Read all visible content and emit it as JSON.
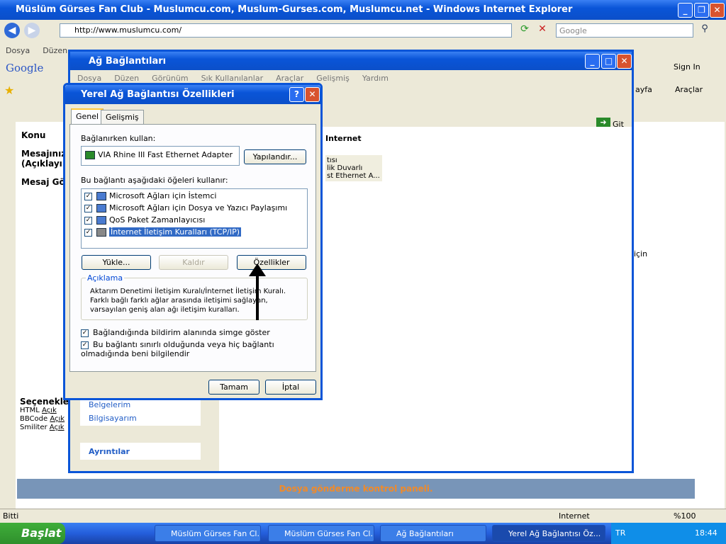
{
  "ie": {
    "title": "Müslüm Gürses Fan Club - Muslumcu.com, Muslum-Gurses.com, Muslumcu.net - Windows Internet Explorer",
    "address": "http://www.muslumcu.com/",
    "search_placeholder": "Google",
    "menu": [
      "Dosya",
      "Düzen"
    ],
    "google_label": "Google",
    "sign_in": "Sign In",
    "sayfa": "ayfa",
    "araclar": "Araçlar",
    "status": "Bitti",
    "zone": "Internet",
    "zoom": "%100"
  },
  "page": {
    "konu": "Konu",
    "mesajiniz": "Mesajınız (Açıklayı",
    "mesaj_go": "Mesaj Gö",
    "secenekler": "Seçenekle",
    "html": "HTML",
    "bbcode": "BBCode",
    "smiliter": "Smiliter",
    "acik": "Açık",
    "bottom_bar": "Dosya gönderme kontrol paneli.",
    "icin": "için"
  },
  "net": {
    "title": "Ağ Bağlantıları",
    "menu": [
      "Dosya",
      "Düzen",
      "Görünüm",
      "Sık Kullanılanlar",
      "Araçlar",
      "Gelişmiş",
      "Yardım"
    ],
    "go": "Git",
    "col_internet": "Internet",
    "rows": [
      "tısı",
      "lik Duvarlı",
      "st Ethernet A..."
    ],
    "side_links": [
      "Belgelerim",
      "Bilgisayarım"
    ],
    "ayrintilar": "Ayrıntılar"
  },
  "dlg": {
    "title": "Yerel Ağ Bağlantısı Özellikleri",
    "tabs": [
      "Genel",
      "Gelişmiş"
    ],
    "connect_using": "Bağlanırken kullan:",
    "adapter": "VIA Rhine III Fast Ethernet Adapter",
    "configure": "Yapılandır...",
    "items_label": "Bu bağlantı aşağıdaki öğeleri kullanır:",
    "items": [
      "Microsoft Ağları için İstemci",
      "Microsoft Ağları için Dosya ve Yazıcı Paylaşımı",
      "QoS Paket Zamanlayıcısı",
      "İnternet İletişim Kuralları (TCP/IP)"
    ],
    "install": "Yükle...",
    "uninstall": "Kaldır",
    "properties": "Özellikler",
    "desc_title": "Açıklama",
    "desc": "Aktarım Denetimi İletişim Kuralı/İnternet İletişim Kuralı. Farklı bağlı farklı ağlar arasında iletişimi sağlayan, varsayılan geniş alan ağı iletişim kuralları.",
    "show_icon": "Bağlandığında bildirim alanında simge göster",
    "notify": "Bu bağlantı sınırlı olduğunda veya hiç bağlantı olmadığında beni bilgilendir",
    "ok": "Tamam",
    "cancel": "İptal"
  },
  "taskbar": {
    "start": "Başlat",
    "tasks": [
      "Müslüm Gürses Fan Cl...",
      "Müslüm Gürses Fan Cl...",
      "Ağ Bağlantıları",
      "Yerel Ağ Bağlantısı Öz..."
    ],
    "lang": "TR",
    "clock": "18:44"
  }
}
